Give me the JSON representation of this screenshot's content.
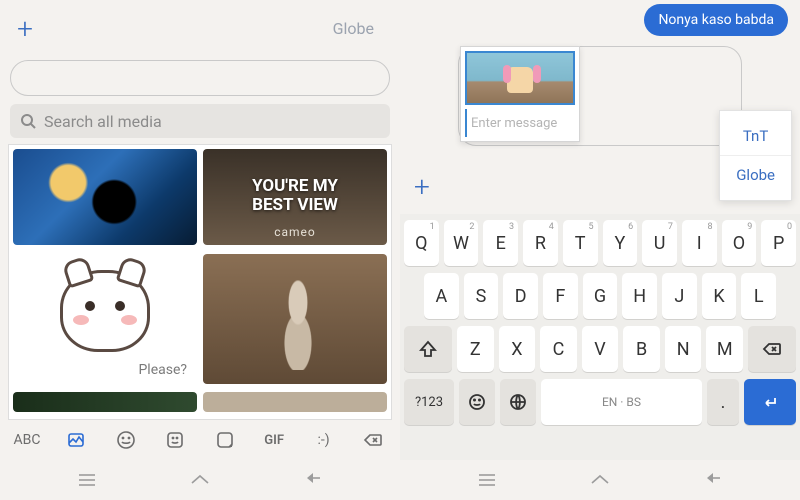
{
  "left": {
    "sim_label": "Globe",
    "search_placeholder": "Search all media",
    "gif2_text": "YOU'RE MY\nBEST VIEW",
    "gif2_brand": "cameo",
    "gif3_label": "Please?",
    "toolbar": {
      "abc": "ABC",
      "gif": "GIF",
      "emoticon": ":-)"
    }
  },
  "right": {
    "received_msg": "Nonya kaso babda",
    "input_placeholder": "Enter message",
    "sim_options": [
      "TnT",
      "Globe"
    ],
    "keyboard": {
      "row1": [
        {
          "k": "Q",
          "s": "1"
        },
        {
          "k": "W",
          "s": "2"
        },
        {
          "k": "E",
          "s": "3"
        },
        {
          "k": "R",
          "s": "4"
        },
        {
          "k": "T",
          "s": "5"
        },
        {
          "k": "Y",
          "s": "6"
        },
        {
          "k": "U",
          "s": "7"
        },
        {
          "k": "I",
          "s": "8"
        },
        {
          "k": "O",
          "s": "9"
        },
        {
          "k": "P",
          "s": "0"
        }
      ],
      "row2": [
        "A",
        "S",
        "D",
        "F",
        "G",
        "H",
        "J",
        "K",
        "L"
      ],
      "row3": [
        "Z",
        "X",
        "C",
        "V",
        "B",
        "N",
        "M"
      ],
      "sym": "?123",
      "comma": ",",
      "space": "EN · BS",
      "period": "."
    }
  }
}
